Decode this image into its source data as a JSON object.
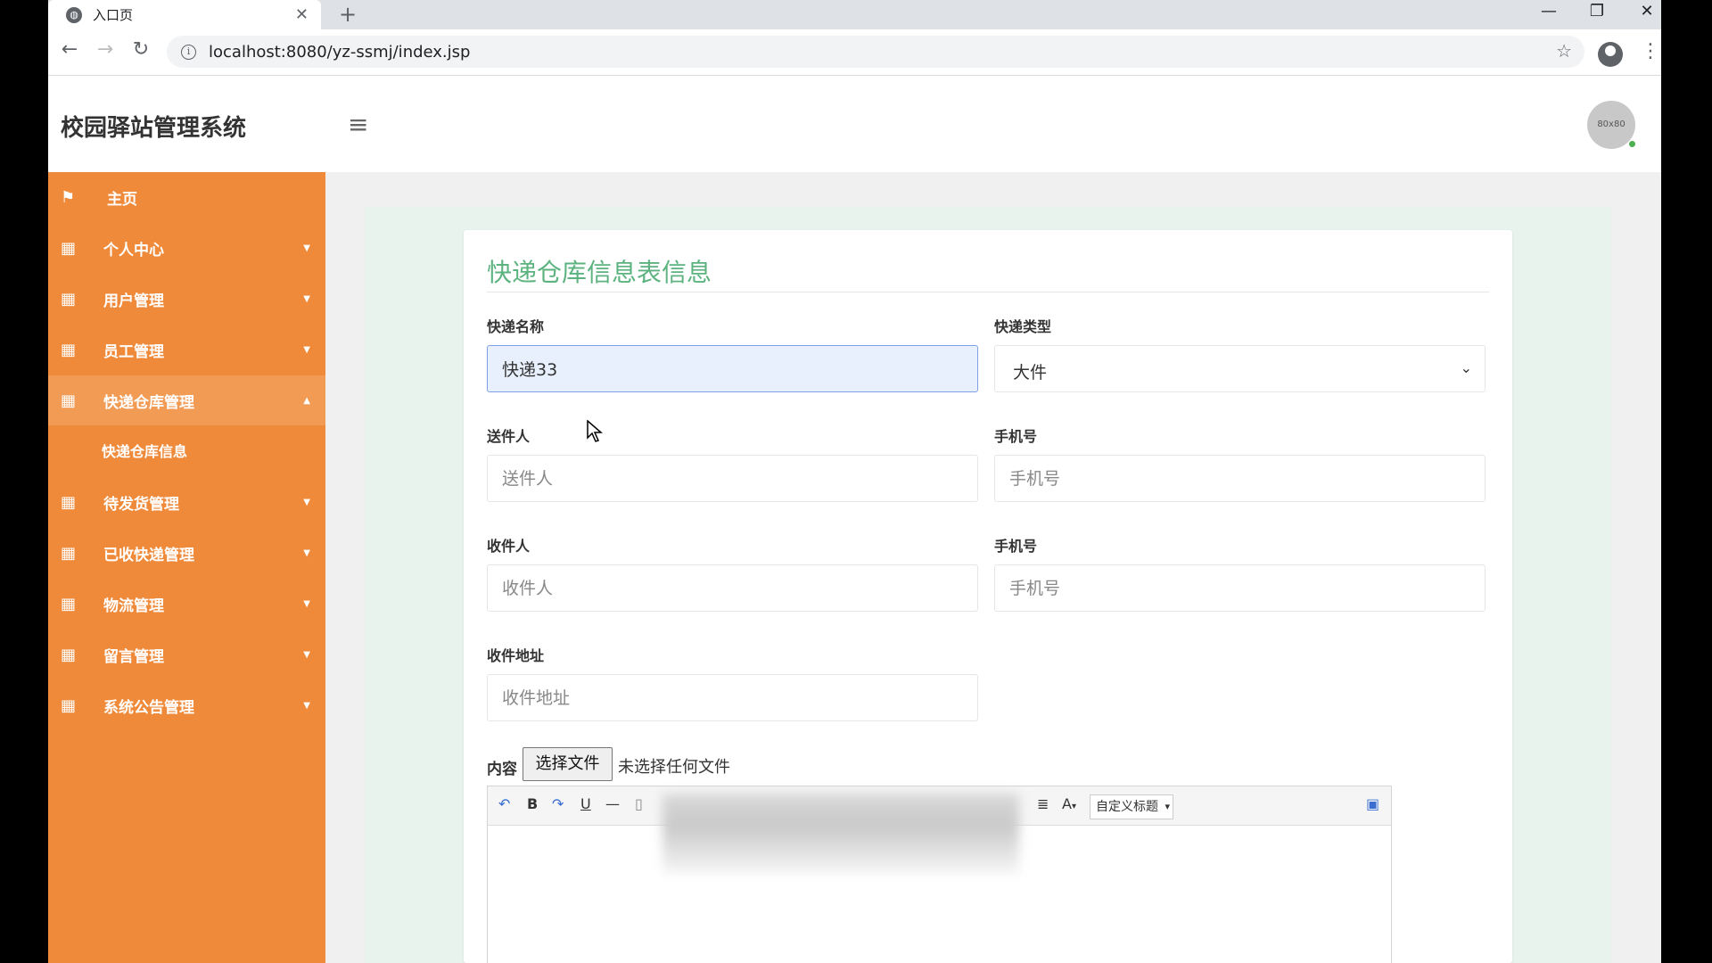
{
  "browser": {
    "tab_title": "入口页",
    "url": "localhost:8080/yz-ssmj/index.jsp",
    "new_tab_symbol": "+",
    "window_controls": [
      "—",
      "❐",
      "✕"
    ]
  },
  "app": {
    "title": "校园驿站管理系统",
    "avatar_text": "80x80",
    "accent_color": "#ef8a3a",
    "title_color": "#5cb37f"
  },
  "sidebar": {
    "items": [
      {
        "label": "主页",
        "icon": "flag-icon",
        "caret": ""
      },
      {
        "label": "个人中心",
        "icon": "grid-icon",
        "caret": "▼"
      },
      {
        "label": "用户管理",
        "icon": "grid-icon",
        "caret": "▼"
      },
      {
        "label": "员工管理",
        "icon": "grid-icon",
        "caret": "▼"
      },
      {
        "label": "快递仓库管理",
        "icon": "grid-icon",
        "caret": "▲",
        "active": true
      },
      {
        "label": "待发货管理",
        "icon": "grid-icon",
        "caret": "▼"
      },
      {
        "label": "已收快递管理",
        "icon": "grid-icon",
        "caret": "▼"
      },
      {
        "label": "物流管理",
        "icon": "grid-icon",
        "caret": "▼"
      },
      {
        "label": "留言管理",
        "icon": "grid-icon",
        "caret": "▼"
      },
      {
        "label": "系统公告管理",
        "icon": "grid-icon",
        "caret": "▼"
      }
    ],
    "submenu": {
      "label": "快递仓库信息"
    }
  },
  "form": {
    "title": "快递仓库信息表信息",
    "express_name": {
      "label": "快递名称",
      "value": "快递33"
    },
    "express_type": {
      "label": "快递类型",
      "value": "大件"
    },
    "sender": {
      "label": "送件人",
      "placeholder": "送件人"
    },
    "sender_phone": {
      "label": "手机号",
      "placeholder": "手机号"
    },
    "receiver": {
      "label": "收件人",
      "placeholder": "收件人"
    },
    "receiver_phone": {
      "label": "手机号",
      "placeholder": "手机号"
    },
    "address": {
      "label": "收件地址",
      "placeholder": "收件地址"
    },
    "content": {
      "label": "内容",
      "file_button": "选择文件",
      "file_status": "未选择任何文件"
    },
    "editor": {
      "heading_select": "自定义标题",
      "bold": "B",
      "underline": "U",
      "font_color": "A"
    }
  }
}
